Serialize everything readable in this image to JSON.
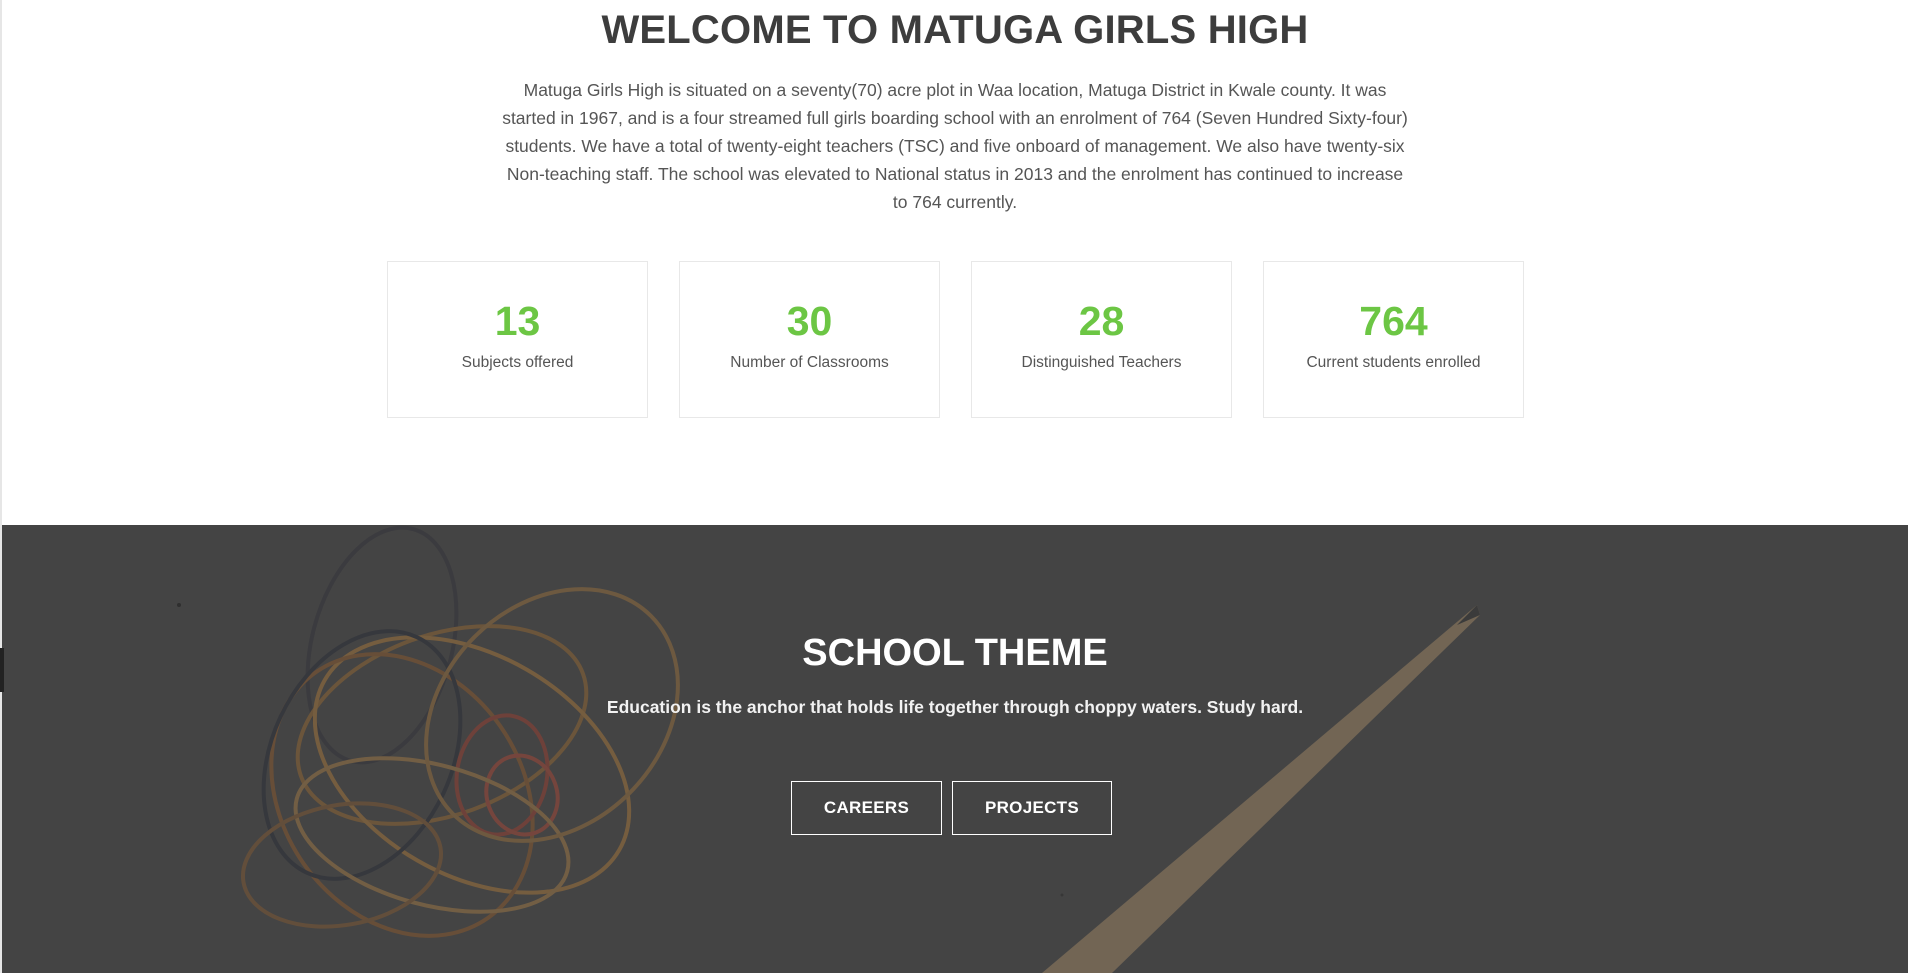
{
  "welcome": {
    "title": "WELCOME TO MATUGA GIRLS HIGH",
    "description": "Matuga Girls High is situated on a seventy(70) acre plot in Waa location, Matuga District in Kwale county. It was started in 1967, and is a four streamed full girls boarding school with an enrolment of 764 (Seven Hundred Sixty-four) students. We have a total of twenty-eight teachers (TSC) and five onboard of management. We also have twenty-six Non-teaching staff. The school was elevated to National status in 2013 and the enrolment has continued to increase to 764 currently."
  },
  "stats": [
    {
      "value": "13",
      "label": "Subjects offered"
    },
    {
      "value": "30",
      "label": "Number of Classrooms"
    },
    {
      "value": "28",
      "label": "Distinguished Teachers"
    },
    {
      "value": "764",
      "label": "Current students enrolled"
    }
  ],
  "theme": {
    "title": "SCHOOL THEME",
    "subtitle": "Education is the anchor that holds life together through choppy waters. Study hard.",
    "buttons": {
      "careers": "CAREERS",
      "projects": "PROJECTS"
    }
  },
  "colors": {
    "accent": "#6cc644",
    "heading": "#3d3d3d",
    "theme_bg": "#4a4a4a"
  }
}
